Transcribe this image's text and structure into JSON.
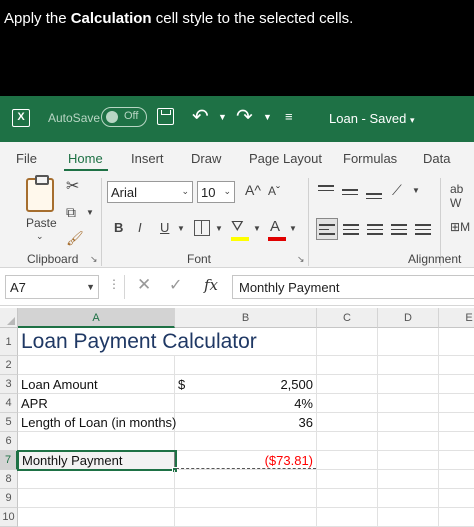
{
  "instruction": {
    "prefix": "Apply the ",
    "highlight": "Calculation",
    "suffix": " cell style to the selected cells."
  },
  "titlebar": {
    "autosave_label": "AutoSave",
    "autosave_state": "Off",
    "document_title": "Loan - Saved",
    "title_caret": "⌄",
    "undo_glyph": "↶",
    "redo_glyph": "↷",
    "qat_more_glyph": "⌅",
    "app_icon_glyph": "X"
  },
  "tabs": [
    "File",
    "Home",
    "Insert",
    "Draw",
    "Page Layout",
    "Formulas",
    "Data"
  ],
  "active_tab": "Home",
  "ribbon": {
    "clipboard": {
      "label": "Clipboard",
      "paste_label": "Paste"
    },
    "font": {
      "label": "Font",
      "font_name": "Arial",
      "font_size": "10",
      "grow_glyph": "A^",
      "shrink_glyph": "Aˇ",
      "bold": "B",
      "italic": "I",
      "underline": "U",
      "font_color_glyph": "A",
      "fill_glyph": "⛛"
    },
    "alignment": {
      "label": "Alignment",
      "orientation_glyph": "ab",
      "wrap_label": "ab W",
      "merge_label": "M"
    }
  },
  "formula_bar": {
    "name_box": "A7",
    "content": "Monthly Payment",
    "fx_label": "fx",
    "cancel_glyph": "✕",
    "enter_glyph": "✓",
    "dots": "⋮"
  },
  "grid": {
    "columns": [
      "A",
      "B",
      "C",
      "D",
      "E"
    ],
    "selected_column": "A",
    "rows": [
      "1",
      "2",
      "3",
      "4",
      "5",
      "6",
      "7",
      "8",
      "9",
      "10"
    ],
    "selected_row": "7",
    "cells": {
      "A1": "Loan Payment Calculator",
      "A3": "Loan Amount",
      "B3_currency": "$",
      "B3": "2,500",
      "A4": "APR",
      "B4": "4%",
      "A5": "Length of Loan (in months)",
      "B5": "36",
      "A7": "Monthly Payment",
      "B7": "($73.81)"
    }
  },
  "colors": {
    "excel_green": "#1e7145",
    "negative_red": "#ff0000",
    "title_blue": "#1f3864"
  }
}
